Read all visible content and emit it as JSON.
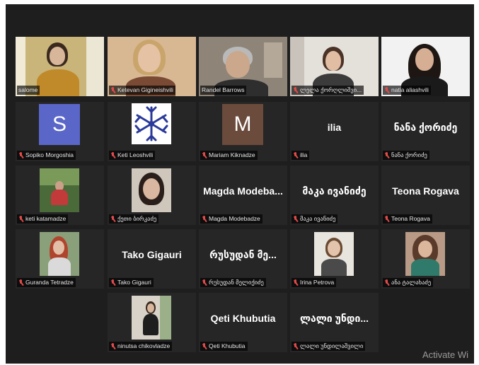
{
  "meeting": {
    "active_speaker_color": "#c8e05a",
    "participants": [
      {
        "name": "salome",
        "muted": false,
        "video": true,
        "active": true
      },
      {
        "name": "Ketevan Gigineishvili",
        "muted": true,
        "video": true
      },
      {
        "name": "Randel Barrows",
        "muted": false,
        "video": true
      },
      {
        "name": "ლელა ქორღლიშვი...",
        "muted": true,
        "video": true
      },
      {
        "name": "natia aliashvili",
        "muted": true,
        "video": true
      },
      {
        "name": "Sopiko Morgoshia",
        "muted": true,
        "avatar_letter": "S",
        "avatar_color": "#5a67c8"
      },
      {
        "name": "Keti Leoshvili",
        "muted": true,
        "avatar_icon": "snowflake-icon"
      },
      {
        "name": "Mariam Kiknadze",
        "muted": true,
        "avatar_letter": "M",
        "avatar_color": "#6b4b3c"
      },
      {
        "name": "ilia",
        "muted": true,
        "display_name": "ilia"
      },
      {
        "name": "ნანა ქორიძე",
        "muted": true,
        "display_name": "ნანა ქორიძე"
      },
      {
        "name": "keti katamadze",
        "muted": true,
        "photo": true
      },
      {
        "name": "ქეთი ბირკაძე",
        "muted": true,
        "photo": true
      },
      {
        "name": "Magda Modebadze",
        "muted": true,
        "display_name": "Magda Modeba..."
      },
      {
        "name": "მაკა ივანიძე",
        "muted": true,
        "display_name": "მაკა ივანიძე"
      },
      {
        "name": "Teona Rogava",
        "muted": true,
        "display_name": "Teona Rogava"
      },
      {
        "name": "Guranda Tetradze",
        "muted": true,
        "photo": true
      },
      {
        "name": "Tako Gigauri",
        "muted": true,
        "display_name": "Tako Gigauri"
      },
      {
        "name": "რუსუდან მელიქიძე",
        "muted": true,
        "display_name": "რუსუდან მე..."
      },
      {
        "name": "Irina Petrova",
        "muted": true,
        "photo": true
      },
      {
        "name": "ანა ტალახაძე",
        "muted": true,
        "photo": true
      },
      {
        "name": "ninutsa chikovladze",
        "muted": true,
        "photo": true
      },
      {
        "name": "Qeti Khubutia",
        "muted": true,
        "display_name": "Qeti Khubutia"
      },
      {
        "name": "ლალი უნდილაშვილი",
        "muted": true,
        "display_name": "ლალი უნდი..."
      }
    ]
  },
  "watermark": {
    "text": "Activate Wi"
  }
}
